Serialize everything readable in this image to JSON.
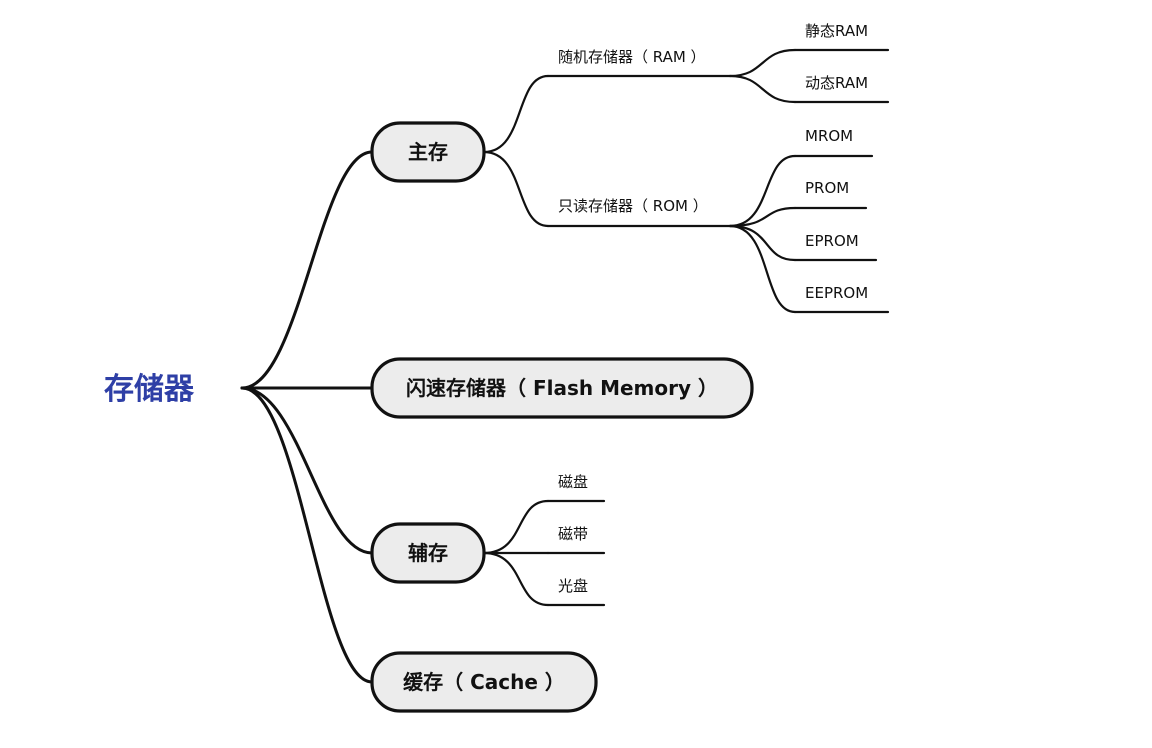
{
  "mindmap": {
    "root": "存储器",
    "root_color": "#2e3fa6",
    "branches": [
      {
        "label": "主存",
        "children": [
          {
            "label": "随机存储器（ RAM ）",
            "children": [
              "静态RAM",
              "动态RAM"
            ]
          },
          {
            "label": "只读存储器（ ROM ）",
            "children": [
              "MROM",
              "PROM",
              "EPROM",
              "EEPROM"
            ]
          }
        ]
      },
      {
        "label": "闪速存储器（ Flash Memory ）",
        "children": []
      },
      {
        "label": "辅存",
        "children": [
          {
            "label": "磁盘"
          },
          {
            "label": "磁带"
          },
          {
            "label": "光盘"
          }
        ]
      },
      {
        "label": "缓存（ Cache ）",
        "children": []
      }
    ]
  }
}
